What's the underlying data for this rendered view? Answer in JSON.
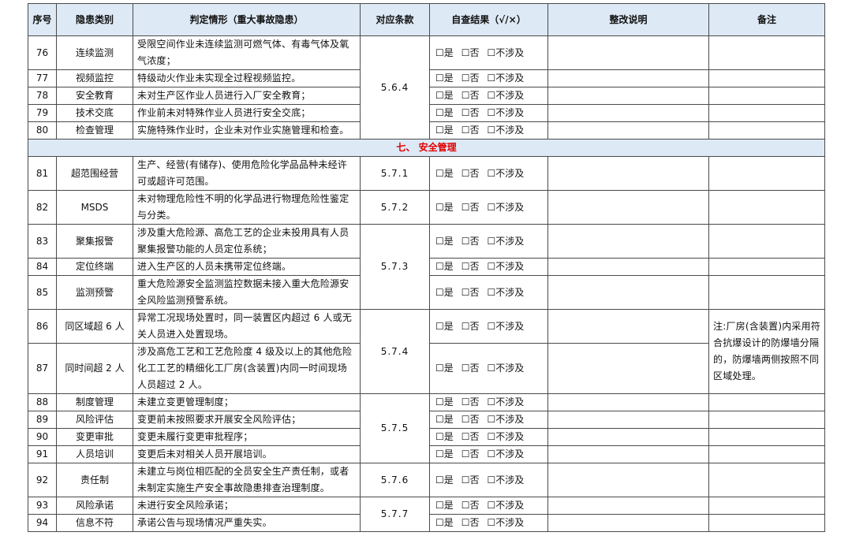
{
  "headers": {
    "no": "序号",
    "category": "隐患类别",
    "criteria": "判定情形（重大事故隐患）",
    "clause": "对应条款",
    "result": "自查结果（√/×）",
    "rectify": "整改说明",
    "remark": "备注"
  },
  "options": [
    "☐是",
    "☐否",
    "☐不涉及"
  ],
  "section_title": "七、 安全管理",
  "rows": [
    {
      "no": "76",
      "category": "连续监测",
      "text": "受限空间作业未连续监测可燃气体、有毒气体及氧气浓度；"
    },
    {
      "no": "77",
      "category": "视频监控",
      "text": "特级动火作业未实现全过程视频监控。"
    },
    {
      "no": "78",
      "category": "安全教育",
      "text": "未对生产区作业人员进行入厂安全教育；"
    },
    {
      "no": "79",
      "category": "技术交底",
      "text": "作业前未对特殊作业人员进行安全交底；"
    },
    {
      "no": "80",
      "category": "检查管理",
      "text": "实施特殊作业时，企业未对作业实施管理和检查。"
    },
    {
      "no": "81",
      "category": "超范围经营",
      "text": "生产、经营(有储存)、使用危险化学品品种未经许可或超许可范围。"
    },
    {
      "no": "82",
      "category": "MSDS",
      "text": "未对物理危险性不明的化学品进行物理危险性鉴定与分类。"
    },
    {
      "no": "83",
      "category": "聚集报警",
      "text": "涉及重大危险源、高危工艺的企业未投用具有人员聚集报警功能的人员定位系统；"
    },
    {
      "no": "84",
      "category": "定位终端",
      "text": "进入生产区的人员未携带定位终端。"
    },
    {
      "no": "85",
      "category": "监测预警",
      "text": "重大危险源安全监测监控数据未接入重大危险源安全风险监测预警系统。"
    },
    {
      "no": "86",
      "category": "同区域超 6 人",
      "text": "异常工况现场处置时，同一装置区内超过 6 人或无关人员进入处置现场。"
    },
    {
      "no": "87",
      "category": "同时间超 2 人",
      "text": "涉及高危工艺和工艺危险度 4 级及以上的其他危险化工工艺的精细化工厂房(含装置)内同一时间现场人员超过 2 人。"
    },
    {
      "no": "88",
      "category": "制度管理",
      "text": "未建立变更管理制度；"
    },
    {
      "no": "89",
      "category": "风险评估",
      "text": "变更前未按照要求开展安全风险评估；"
    },
    {
      "no": "90",
      "category": "变更审批",
      "text": "变更未履行变更审批程序；"
    },
    {
      "no": "91",
      "category": "人员培训",
      "text": "变更后未对相关人员开展培训。"
    },
    {
      "no": "92",
      "category": "责任制",
      "text": "未建立与岗位相匹配的全员安全生产责任制，或者未制定实施生产安全事故隐患排查治理制度。"
    },
    {
      "no": "93",
      "category": "风险承诺",
      "text": "未进行安全风险承诺；"
    },
    {
      "no": "94",
      "category": "信息不符",
      "text": "承诺公告与现场情况严重失实。"
    }
  ],
  "clauses": {
    "c564": "5.6.4",
    "c571": "5.7.1",
    "c572": "5.7.2",
    "c573": "5.7.3",
    "c574": "5.7.4",
    "c575": "5.7.5",
    "c576": "5.7.6",
    "c577": "5.7.7"
  },
  "remark_86_87": "注:厂房(含装置)内采用符合抗爆设计的防爆墙分隔的，防爆墙两侧按照不同区域处理。"
}
